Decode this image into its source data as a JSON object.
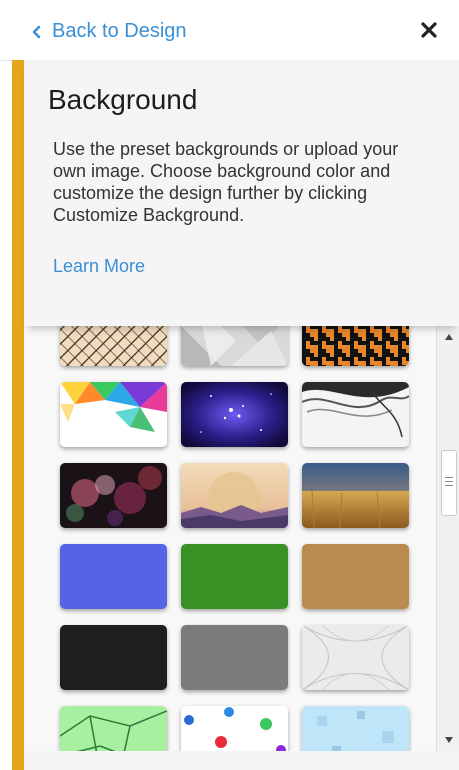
{
  "topbar": {
    "back_label": "Back to Design",
    "back_icon": "chevron-left-icon",
    "close_icon": "close-icon"
  },
  "header": {
    "title": "Background",
    "description": "Use the preset backgrounds or upload your own image. Choose background color and customize the design further by clicking Customize Background.",
    "learn_more": "Learn More"
  },
  "colors": {
    "accent": "#e5a61c",
    "link": "#3a8fd6",
    "panel": "#f5f5f5"
  },
  "gallery": {
    "tiles": [
      {
        "name": "crosshatch-wood-pattern"
      },
      {
        "name": "gray-geometric-pattern"
      },
      {
        "name": "orange-houndstooth-pattern"
      },
      {
        "name": "colorful-polygon-art"
      },
      {
        "name": "purple-galaxy"
      },
      {
        "name": "monochrome-hair-art"
      },
      {
        "name": "bokeh-lights"
      },
      {
        "name": "sunset-sun-landscape"
      },
      {
        "name": "wheat-field"
      },
      {
        "name": "blue-textured-paper"
      },
      {
        "name": "green-grass"
      },
      {
        "name": "brown-kraft-paper"
      },
      {
        "name": "black-texture"
      },
      {
        "name": "gray-texture"
      },
      {
        "name": "light-gray-line-pattern"
      },
      {
        "name": "green-geometric-lines"
      },
      {
        "name": "polka-dot-confetti"
      },
      {
        "name": "light-blue-squares"
      }
    ]
  },
  "scrollbar": {
    "up_icon": "scroll-up-arrow-icon",
    "down_icon": "scroll-down-arrow-icon"
  }
}
